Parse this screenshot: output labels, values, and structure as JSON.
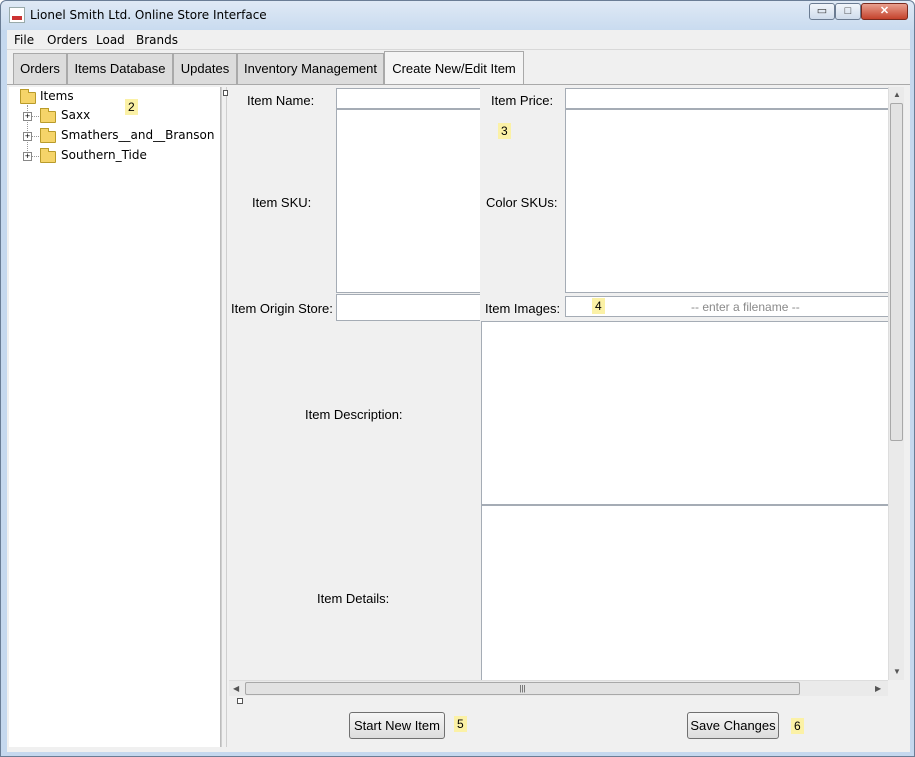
{
  "window": {
    "title": "Lionel Smith Ltd. Online Store Interface",
    "min": "▭",
    "max": "□",
    "close": "✕"
  },
  "menu": [
    "File",
    "Orders",
    "Load",
    "Brands"
  ],
  "tabs": [
    "Orders",
    "Items Database",
    "Updates",
    "Inventory Management",
    "Create New/Edit Item"
  ],
  "active_tab": "Create New/Edit Item",
  "tree": {
    "root": "Items",
    "children": [
      "Saxx",
      "Smathers__and__Branson",
      "Southern_Tide"
    ]
  },
  "form": {
    "item_name_label": "Item Name:",
    "item_price_label": "Item Price:",
    "item_sku_label": "Item SKU:",
    "color_skus_label": "Color SKUs:",
    "origin_store_label": "Item Origin Store:",
    "images_label": "Item Images:",
    "images_placeholder": "-- enter a filename --",
    "description_label": "Item Description:",
    "details_label": "Item Details:"
  },
  "buttons": {
    "start_new": "Start New Item",
    "save": "Save Changes"
  },
  "badges": [
    "2",
    "3",
    "4",
    "5",
    "6"
  ],
  "scroll": {
    "grip": "|||"
  }
}
